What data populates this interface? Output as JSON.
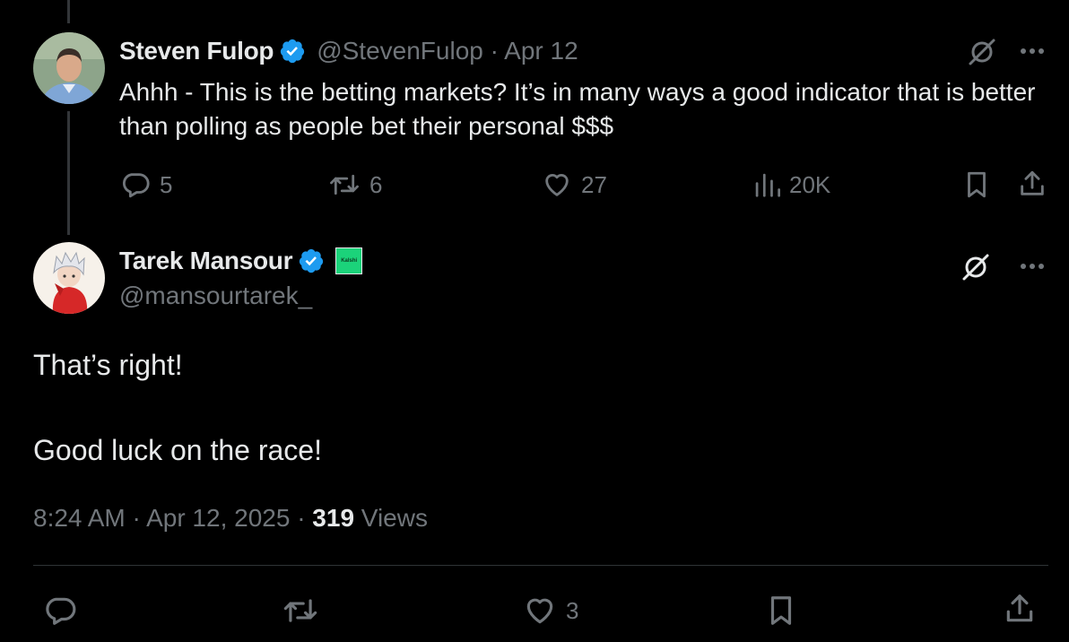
{
  "parent_post": {
    "display_name": "Steven Fulop",
    "handle_date": "@StevenFulop · Apr 12",
    "text": "Ahhh - This is the betting markets? It’s in many ways a good indicator that is better than polling as people bet their personal $$$",
    "actions": {
      "replies": "5",
      "reposts": "6",
      "likes": "27",
      "views": "20K"
    }
  },
  "main_post": {
    "display_name": "Tarek Mansour",
    "handle": "@mansourtarek_",
    "affiliation_badge": "Kalshi",
    "paragraphs": [
      "That’s right!",
      "Good luck on the race!"
    ],
    "time": "8:24 AM · Apr 12, 2025 · ",
    "views_count": "319",
    "views_label": " Views",
    "actions": {
      "likes": "3"
    }
  },
  "colors": {
    "background": "#000000",
    "text_primary": "#e7e9ea",
    "text_secondary": "#71767b",
    "verified_blue": "#1d9bf0",
    "divider": "#2f3336",
    "affiliation_badge": "#1bd37a"
  },
  "icons": {
    "verified": "verified-badge-icon",
    "grok": "grok-icon",
    "more": "more-icon",
    "reply": "reply-icon",
    "repost": "repost-icon",
    "like": "heart-icon",
    "views": "views-chart-icon",
    "bookmark": "bookmark-icon",
    "share": "share-icon"
  }
}
